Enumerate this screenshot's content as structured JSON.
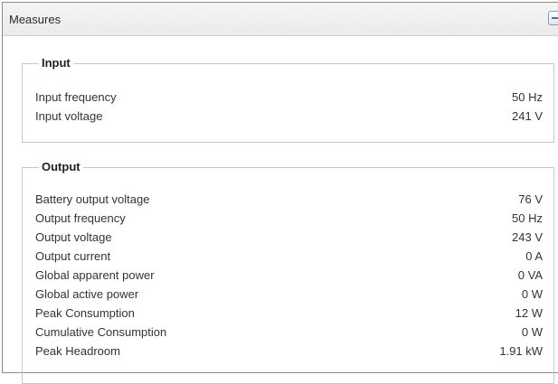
{
  "panel": {
    "title": "Measures"
  },
  "input": {
    "legend": "Input",
    "rows": [
      {
        "label": "Input frequency",
        "value": "50 Hz"
      },
      {
        "label": "Input voltage",
        "value": "241 V"
      }
    ]
  },
  "output": {
    "legend": "Output",
    "rows": [
      {
        "label": "Battery output voltage",
        "value": "76 V"
      },
      {
        "label": "Output frequency",
        "value": "50 Hz"
      },
      {
        "label": "Output voltage",
        "value": "243 V"
      },
      {
        "label": "Output current",
        "value": "0 A"
      },
      {
        "label": "Global apparent power",
        "value": "0 VA"
      },
      {
        "label": "Global active power",
        "value": "0 W"
      },
      {
        "label": "Peak Consumption",
        "value": "12 W"
      },
      {
        "label": "Cumulative Consumption",
        "value": "0 W"
      },
      {
        "label": "Peak Headroom",
        "value": "1.91 kW"
      }
    ]
  },
  "icons": {
    "collapse": "minus-icon"
  },
  "colors": {
    "panel_border": "#8a8a8a",
    "group_border": "#c7c7c7",
    "button_border": "#7c9fc2"
  }
}
